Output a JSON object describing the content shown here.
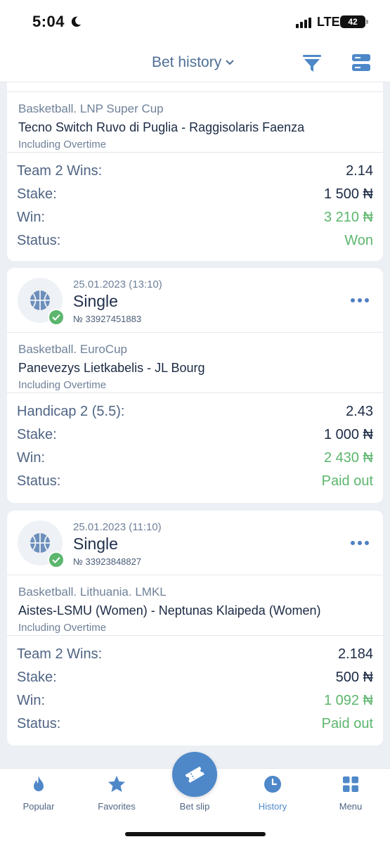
{
  "status_bar": {
    "time": "5:04",
    "network": "LTE",
    "battery": "42"
  },
  "header": {
    "title": "Bet history"
  },
  "cards": [
    {
      "event": {
        "league": "Basketball. LNP Super Cup",
        "teams": "Tecno Switch Ruvo di Puglia - Raggisolaris Faenza",
        "note": "Including Overtime"
      },
      "rows": [
        {
          "label": "Team 2 Wins:",
          "value": "2.14"
        },
        {
          "label": "Stake:",
          "value": "1 500 ₦"
        },
        {
          "label": "Win:",
          "value": "3 210 ₦"
        },
        {
          "label": "Status:",
          "value": "Won"
        }
      ]
    },
    {
      "date": "25.01.2023 (13:10)",
      "type": "Single",
      "number": "№ 33927451883",
      "event": {
        "league": "Basketball. EuroCup",
        "teams": "Panevezys Lietkabelis - JL Bourg",
        "note": "Including Overtime"
      },
      "rows": [
        {
          "label": "Handicap 2 (5.5):",
          "value": "2.43"
        },
        {
          "label": "Stake:",
          "value": "1 000 ₦"
        },
        {
          "label": "Win:",
          "value": "2 430 ₦"
        },
        {
          "label": "Status:",
          "value": "Paid out"
        }
      ]
    },
    {
      "date": "25.01.2023 (11:10)",
      "type": "Single",
      "number": "№ 33923848827",
      "event": {
        "league": "Basketball. Lithuania. LMKL",
        "teams": "Aistes-LSMU (Women) - Neptunas Klaipeda (Women)",
        "note": "Including Overtime"
      },
      "rows": [
        {
          "label": "Team 2 Wins:",
          "value": "2.184"
        },
        {
          "label": "Stake:",
          "value": "500 ₦"
        },
        {
          "label": "Win:",
          "value": "1 092 ₦"
        },
        {
          "label": "Status:",
          "value": "Paid out"
        }
      ]
    }
  ],
  "nav": {
    "popular": "Popular",
    "favorites": "Favorites",
    "bet_slip": "Bet slip",
    "history": "History",
    "menu": "Menu"
  },
  "colors": {
    "accent": "#4e88c9",
    "success": "#5cb66d",
    "text": "#1b2a44",
    "muted": "#6f8199"
  }
}
